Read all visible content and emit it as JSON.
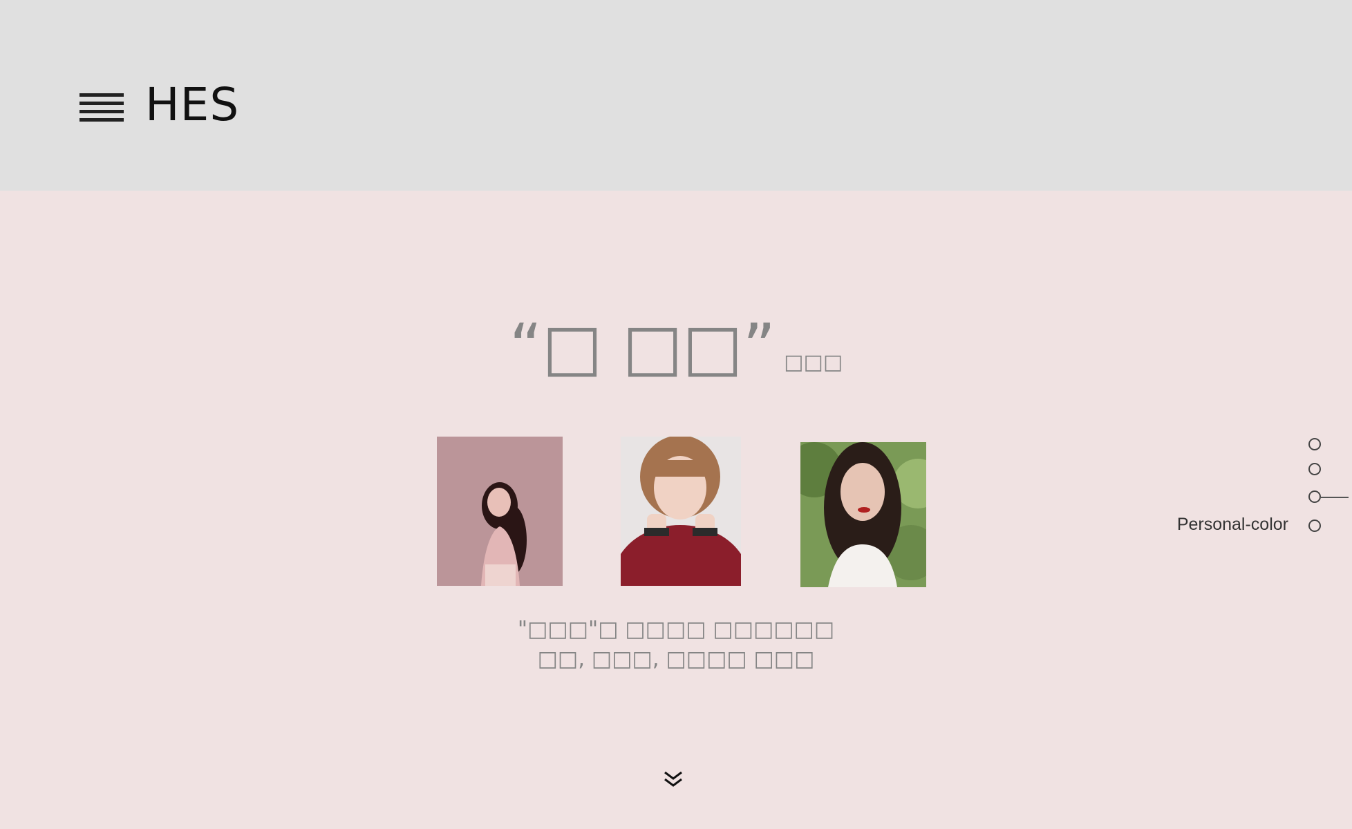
{
  "header": {
    "brand": "HES",
    "menu_icon": "hamburger-icon"
  },
  "headline": {
    "main": "“□ □□”",
    "sub": "□□□"
  },
  "photos": [
    {
      "name": "portrait-1",
      "accent": "#b8939a"
    },
    {
      "name": "portrait-2",
      "accent": "#8b1e2b"
    },
    {
      "name": "portrait-3",
      "accent": "#6a8a4a"
    }
  ],
  "caption": {
    "line1": "\"□□□\"□ □□□□ □□□□□□",
    "line2": "□□, □□□, □□□□ □□□"
  },
  "scroll": {
    "icon": "double-chevron-down-icon"
  },
  "side_nav": {
    "label": "Personal-color",
    "dot_count": 4,
    "active_index": 2
  },
  "colors": {
    "header_bg": "#e0e0e0",
    "page_bg": "#f0e2e2",
    "text_gray": "#858585",
    "text_dark": "#111111"
  }
}
